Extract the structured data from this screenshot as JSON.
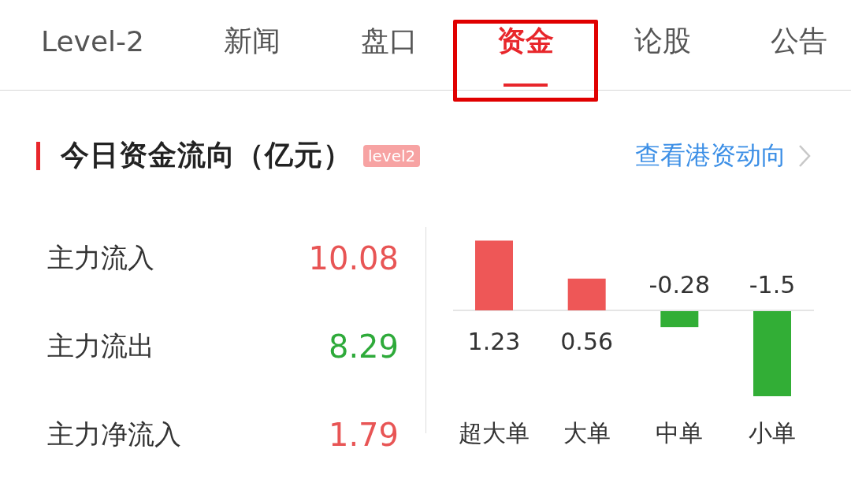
{
  "tabs": [
    {
      "label": "Level-2",
      "selected": false,
      "highlighted": false
    },
    {
      "label": "新闻",
      "selected": false,
      "highlighted": false
    },
    {
      "label": "盘口",
      "selected": false,
      "highlighted": false
    },
    {
      "label": "资金",
      "selected": true,
      "highlighted": true
    },
    {
      "label": "论股",
      "selected": false,
      "highlighted": false
    },
    {
      "label": "公告",
      "selected": false,
      "highlighted": false
    }
  ],
  "section": {
    "title": "今日资金流向（亿元）",
    "badge": "level2",
    "link": "查看港资动向"
  },
  "flows": [
    {
      "label": "主力流入",
      "value": "10.08",
      "color": "#e85555"
    },
    {
      "label": "主力流出",
      "value": "8.29",
      "color": "#2eaa3a"
    },
    {
      "label": "主力净流入",
      "value": "1.79",
      "color": "#e85555"
    }
  ],
  "chart_data": {
    "type": "bar",
    "categories": [
      "超大单",
      "大单",
      "中单",
      "小单"
    ],
    "values": [
      1.23,
      0.56,
      -0.28,
      -1.5
    ],
    "data_labels": true
  }
}
